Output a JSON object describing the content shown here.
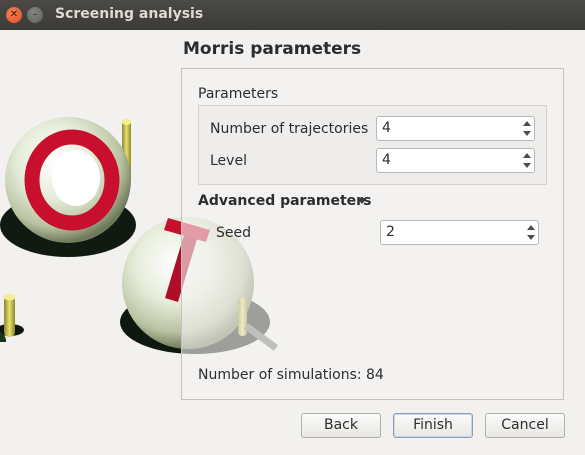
{
  "window": {
    "title": "Screening analysis",
    "close_glyph": "✕",
    "minimize_glyph": "–"
  },
  "page": {
    "heading": "Morris parameters"
  },
  "parameters": {
    "group_label": "Parameters",
    "trajectories_label": "Number of trajectories",
    "trajectories_value": "4",
    "level_label": "Level",
    "level_value": "4"
  },
  "advanced": {
    "label": "Advanced parameters",
    "seed_label": "Seed",
    "seed_value": "2"
  },
  "summary": {
    "simulations_label": "Number of simulations:",
    "simulations_value": "84"
  },
  "buttons": {
    "back": "Back",
    "finish": "Finish",
    "cancel": "Cancel"
  },
  "colors": {
    "titlebar": "#3c3b37",
    "close_button": "#e0511f",
    "sphere_ring": "#c8102e",
    "sphere_body": "#eef3e4",
    "post": "#c8c038"
  },
  "illustration": {
    "description_icon": "openturns-logo-spheres"
  }
}
